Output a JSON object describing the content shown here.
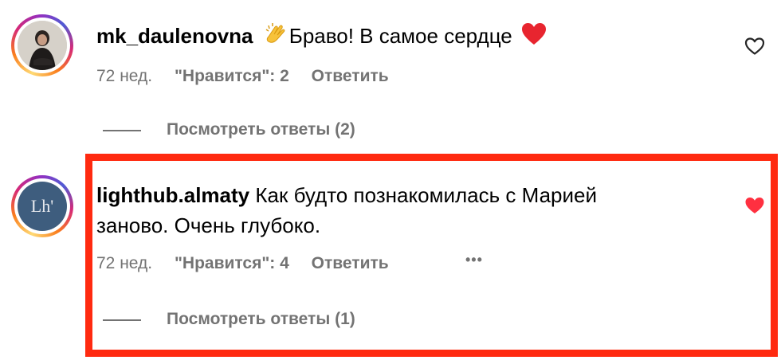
{
  "comments": [
    {
      "username": "mk_daulenovna",
      "text": "Браво! В самое сердце",
      "emoji_prefix": "clapping-hands",
      "emoji_suffix": "red-heart",
      "time": "72 нед.",
      "likes": "\"Нравится\": 2",
      "reply": "Ответить",
      "view_replies": "Посмотреть ответы (2)",
      "liked": false
    },
    {
      "username": "lighthub.almaty",
      "avatar_text": "Lh'",
      "text_line1": "Как будто познакомилась с Марией",
      "text_line2": "заново. Очень глубоко.",
      "time": "72 нед.",
      "likes": "\"Нравится\": 4",
      "reply": "Ответить",
      "more": "•••",
      "view_replies": "Посмотреть ответы (1)",
      "liked": true,
      "highlighted": true
    }
  ],
  "colors": {
    "muted": "#737373",
    "like_red": "#ff3040",
    "highlight": "#ff2a10",
    "avatar2_bg": "#3e5d7e"
  }
}
